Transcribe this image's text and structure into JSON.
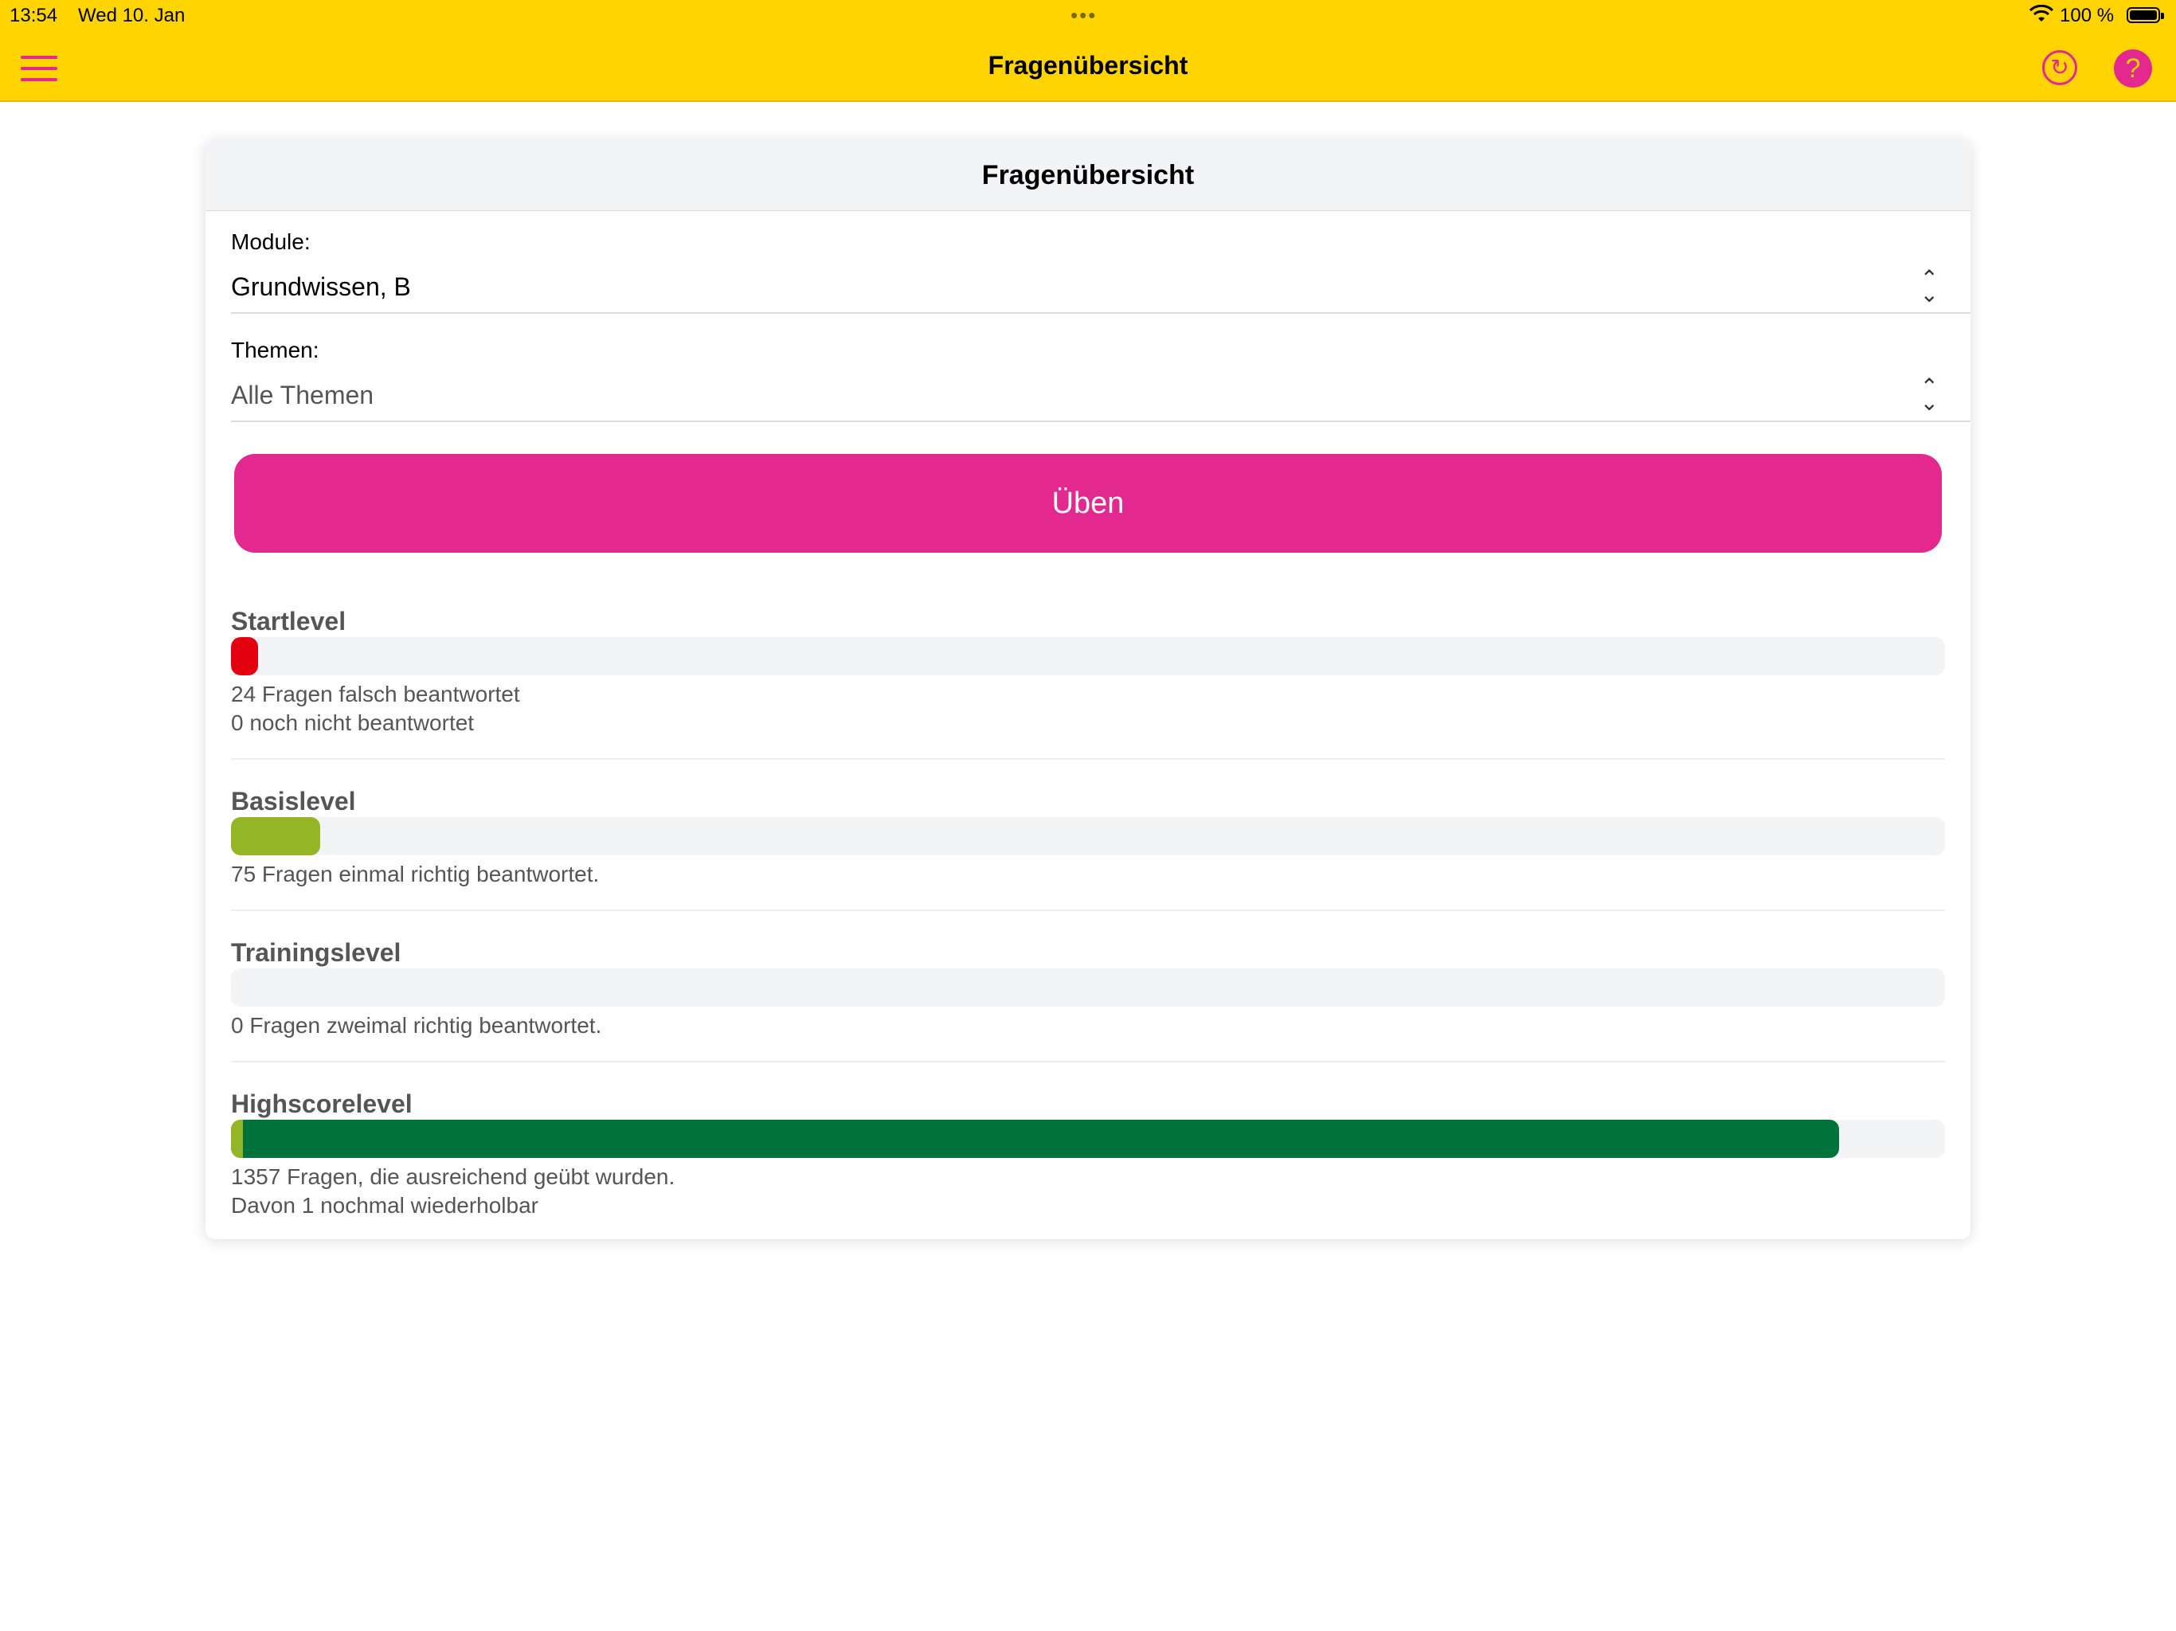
{
  "status_bar": {
    "time": "13:54",
    "date": "Wed 10. Jan",
    "battery_pct": "100 %"
  },
  "nav": {
    "title": "Fragenübersicht",
    "icons": [
      "menu-icon",
      "refresh-icon",
      "help-icon"
    ],
    "accent": "#E3288F",
    "bar_color": "#FFD400"
  },
  "card": {
    "title": "Fragenübersicht",
    "module_label": "Module:",
    "module_value": "Grundwissen, B",
    "themen_label": "Themen:",
    "themen_value": "Alle Themen",
    "practice_label": "Üben"
  },
  "levels": [
    {
      "name": "Startlevel",
      "fill": 0.016,
      "color": "#E3000F",
      "lines": [
        "24 Fragen falsch beantwortet",
        "0 noch nicht beantwortet"
      ]
    },
    {
      "name": "Basislevel",
      "fill": 0.052,
      "color": "#93B526",
      "lines": [
        "75 Fragen einmal richtig beantwortet."
      ]
    },
    {
      "name": "Trainingslevel",
      "fill": 0,
      "color": "#93B526",
      "lines": [
        "0 Fragen zweimal richtig beantwortet."
      ]
    },
    {
      "name": "Highscorelevel",
      "fill": 0.938,
      "color": "#00733C",
      "repeat_fill": 0.007,
      "repeat_color": "#93B526",
      "lines": [
        "1357 Fragen, die ausreichend geübt wurden.",
        "Davon 1 nochmal wiederholbar"
      ]
    }
  ]
}
